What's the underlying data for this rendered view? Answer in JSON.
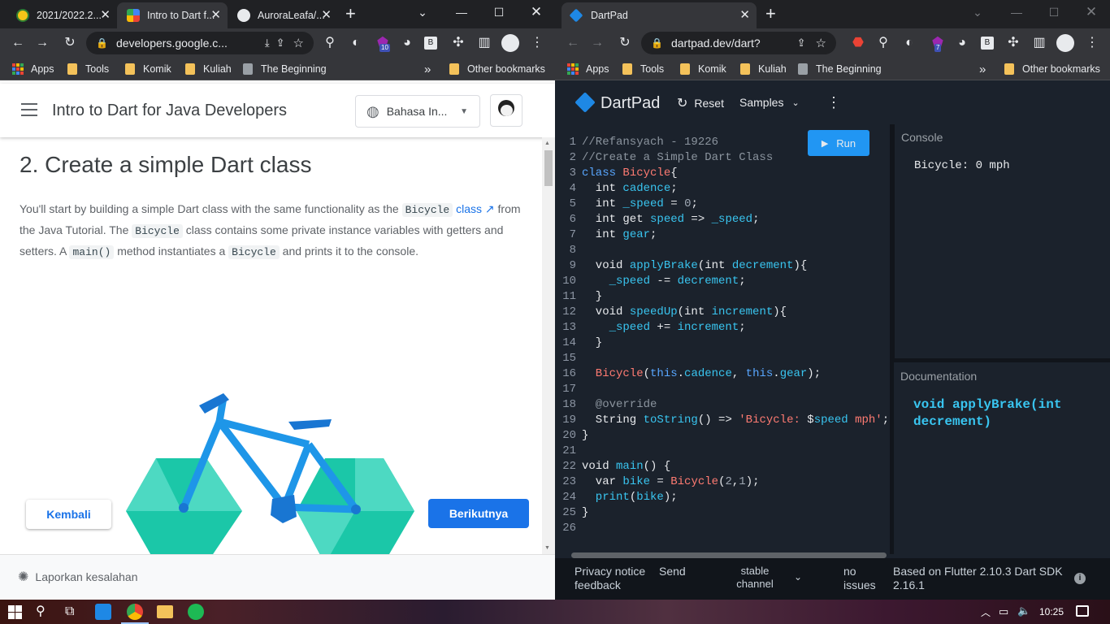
{
  "left_window": {
    "tabs": [
      {
        "label": "2021/2022.2...",
        "active": false
      },
      {
        "label": "Intro to Dart f...",
        "active": true
      },
      {
        "label": "AuroraLeafa/...",
        "active": false
      }
    ],
    "url": "developers.google.c...",
    "extension_badge": "10",
    "bookmarks": [
      "Apps",
      "Tools",
      "Komik",
      "Kuliah",
      "The Beginning"
    ],
    "other_bookmarks": "Other bookmarks",
    "overflow": "»"
  },
  "codelab": {
    "title": "Intro to Dart for Java Developers",
    "language": "Bahasa In...",
    "heading": "2. Create a simple Dart class",
    "paragraph": {
      "p1": "You'll start by building a simple Dart class with the same functionality as the",
      "code1": "Bicycle",
      "link": "class",
      "p2": "from the Java Tutorial. The",
      "code2": "Bicycle",
      "p3": "class contains some private instance variables with getters and setters. A",
      "code3": "main()",
      "p4": "method instantiates a",
      "code4": "Bicycle",
      "p5": "and prints it to the console."
    },
    "back_button": "Kembali",
    "next_button": "Berikutnya",
    "report": "Laporkan kesalahan"
  },
  "right_window": {
    "tab": "DartPad",
    "url": "dartpad.dev/dart?",
    "extension_badge": "7",
    "bookmarks": [
      "Apps",
      "Tools",
      "Komik",
      "Kuliah",
      "The Beginning"
    ],
    "other_bookmarks": "Other bookmarks",
    "overflow": "»"
  },
  "dartpad": {
    "brand": "DartPad",
    "reset": "Reset",
    "samples": "Samples",
    "run": "Run",
    "console_label": "Console",
    "console_output": "Bicycle: 0 mph",
    "doc_label": "Documentation",
    "doc_content": "void applyBrake(int decrement)",
    "line_numbers": [
      "1",
      "2",
      "3",
      "4",
      "5",
      "6",
      "7",
      "8",
      "9",
      "10",
      "11",
      "12",
      "13",
      "14",
      "15",
      "16",
      "17",
      "18",
      "19",
      "20",
      "21",
      "22",
      "23",
      "24",
      "25",
      "26"
    ],
    "footer": {
      "privacy": "Privacy notice",
      "feedback": "feedback",
      "send": "Send",
      "channel": "stable channel",
      "issues": "no issues",
      "sdk": "Based on Flutter 2.10.3 Dart SDK 2.16.1"
    }
  },
  "code_lines": [
    [
      [
        "c",
        "//Refansyach - 19226"
      ]
    ],
    [
      [
        "c",
        "//Create a Simple Dart Class"
      ]
    ],
    [
      [
        "k",
        "class "
      ],
      [
        "t",
        "Bicycle"
      ],
      [
        "p",
        "{"
      ]
    ],
    [
      [
        "p",
        "  int "
      ],
      [
        "v",
        "cadence"
      ],
      [
        "p",
        ";"
      ]
    ],
    [
      [
        "p",
        "  int "
      ],
      [
        "v",
        "_speed"
      ],
      [
        "p",
        " = "
      ],
      [
        "n",
        "0"
      ],
      [
        "p",
        ";"
      ]
    ],
    [
      [
        "p",
        "  int get "
      ],
      [
        "v",
        "speed"
      ],
      [
        "p",
        " => "
      ],
      [
        "v",
        "_speed"
      ],
      [
        "p",
        ";"
      ]
    ],
    [
      [
        "p",
        "  int "
      ],
      [
        "v",
        "gear"
      ],
      [
        "p",
        ";"
      ]
    ],
    [
      [
        "p",
        ""
      ]
    ],
    [
      [
        "p",
        "  void "
      ],
      [
        "f",
        "applyBrake"
      ],
      [
        "p",
        "(int "
      ],
      [
        "v",
        "decrement"
      ],
      [
        "p",
        "){"
      ]
    ],
    [
      [
        "v",
        "    _speed"
      ],
      [
        "p",
        " -= "
      ],
      [
        "v",
        "decrement"
      ],
      [
        "p",
        ";"
      ]
    ],
    [
      [
        "p",
        "  }"
      ]
    ],
    [
      [
        "p",
        "  void "
      ],
      [
        "f",
        "speedUp"
      ],
      [
        "p",
        "(int "
      ],
      [
        "v",
        "increment"
      ],
      [
        "p",
        "){"
      ]
    ],
    [
      [
        "v",
        "    _speed"
      ],
      [
        "p",
        " += "
      ],
      [
        "v",
        "increment"
      ],
      [
        "p",
        ";"
      ]
    ],
    [
      [
        "p",
        "  }"
      ]
    ],
    [
      [
        "p",
        ""
      ]
    ],
    [
      [
        "t",
        "  Bicycle"
      ],
      [
        "p",
        "("
      ],
      [
        "k",
        "this"
      ],
      [
        "p",
        "."
      ],
      [
        "v",
        "cadence"
      ],
      [
        "p",
        ", "
      ],
      [
        "k",
        "this"
      ],
      [
        "p",
        "."
      ],
      [
        "v",
        "gear"
      ],
      [
        "p",
        ");"
      ]
    ],
    [
      [
        "p",
        ""
      ]
    ],
    [
      [
        "c",
        "  @override"
      ]
    ],
    [
      [
        "p",
        "  String "
      ],
      [
        "f",
        "toString"
      ],
      [
        "p",
        "() => "
      ],
      [
        "s",
        "'Bicycle: "
      ],
      [
        "p",
        "$"
      ],
      [
        "v",
        "speed"
      ],
      [
        "s",
        " mph'"
      ],
      [
        "p",
        ";"
      ]
    ],
    [
      [
        "p",
        "}"
      ]
    ],
    [
      [
        "p",
        ""
      ]
    ],
    [
      [
        "p",
        "void "
      ],
      [
        "f",
        "main"
      ],
      [
        "p",
        "() {"
      ]
    ],
    [
      [
        "p",
        "  var "
      ],
      [
        "v",
        "bike"
      ],
      [
        "p",
        " = "
      ],
      [
        "t",
        "Bicycle"
      ],
      [
        "p",
        "("
      ],
      [
        "n",
        "2"
      ],
      [
        "p",
        ","
      ],
      [
        "n",
        "1"
      ],
      [
        "p",
        ");"
      ]
    ],
    [
      [
        "f",
        "  print"
      ],
      [
        "p",
        "("
      ],
      [
        "v",
        "bike"
      ],
      [
        "p",
        ");"
      ]
    ],
    [
      [
        "p",
        "}"
      ]
    ],
    [
      [
        "p",
        ""
      ]
    ]
  ],
  "taskbar": {
    "time": "10:25",
    "icons": [
      "windows-icon",
      "search-icon",
      "task-view-icon",
      "vscode-icon",
      "chrome-icon",
      "file-explorer-icon",
      "spotify-icon"
    ]
  },
  "colors": {
    "chrome_dark": "#202124",
    "chrome_toolbar": "#35363a",
    "google_blue": "#1a73e8",
    "dartpad_bg": "#1b222c",
    "run_button": "#2196f3",
    "bike_wheel": "#1bc7a8",
    "bike_frame": "#1e88e5"
  }
}
